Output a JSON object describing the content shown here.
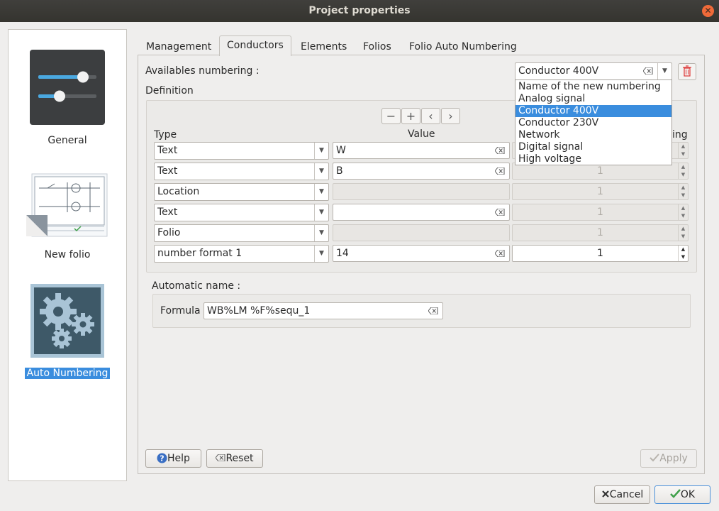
{
  "window": {
    "title": "Project properties"
  },
  "sidebar": {
    "items": [
      {
        "label": "General",
        "selected": false
      },
      {
        "label": "New folio",
        "selected": false
      },
      {
        "label": "Auto Numbering",
        "selected": true
      }
    ]
  },
  "tabs": [
    "Management",
    "Conductors",
    "Elements",
    "Folios",
    "Folio Auto Numbering"
  ],
  "active_tab": "Conductors",
  "numbering": {
    "label": "Availables numbering :",
    "selected": "Conductor 400V",
    "options": [
      "Name of the new numbering",
      "Analog signal",
      "Conductor 400V",
      "Conductor 230V",
      "Network",
      "Digital signal",
      "High voltage"
    ]
  },
  "definition": {
    "label": "Definition",
    "headers": {
      "type": "Type",
      "value": "Value",
      "increase": "ing"
    },
    "rows": [
      {
        "type": "Text",
        "value": "W",
        "value_enabled": true,
        "increase": "",
        "increase_enabled": false
      },
      {
        "type": "Text",
        "value": "B",
        "value_enabled": true,
        "increase": "1",
        "increase_enabled": false
      },
      {
        "type": "Location",
        "value": "",
        "value_enabled": false,
        "increase": "1",
        "increase_enabled": false
      },
      {
        "type": "Text",
        "value": "",
        "value_enabled": true,
        "increase": "1",
        "increase_enabled": false
      },
      {
        "type": "Folio",
        "value": "",
        "value_enabled": false,
        "increase": "1",
        "increase_enabled": false
      },
      {
        "type": "number format 1",
        "value": "14",
        "value_enabled": true,
        "increase": "1",
        "increase_enabled": true
      }
    ]
  },
  "automatic_name": {
    "label": "Automatic name :",
    "formula_label": "Formula",
    "formula_value": "WB%LM %F%sequ_1"
  },
  "buttons": {
    "help": "Help",
    "reset": "Reset",
    "apply": "Apply",
    "cancel": "Cancel",
    "ok": "OK"
  },
  "colors": {
    "accent": "#3a8dde",
    "titlebar": "#3b3a36",
    "close": "#ef6a39"
  }
}
